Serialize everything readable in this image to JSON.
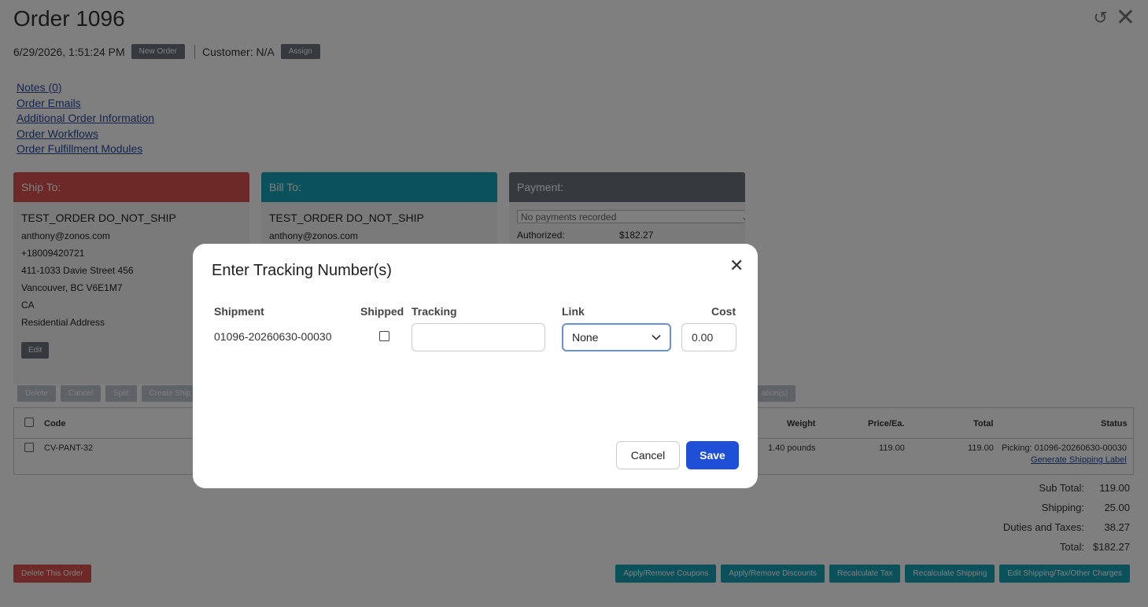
{
  "header": {
    "title": "Order 1096",
    "datetime": "6/29/2026, 1:51:24 PM",
    "new_order_label": "New Order",
    "customer_text": "Customer: N/A",
    "assign_label": "Assign"
  },
  "links": [
    "Notes (0)",
    "Order Emails",
    "Additional Order Information",
    "Order Workflows",
    "Order Fulfillment Modules"
  ],
  "ship_to": {
    "heading": "Ship To:",
    "name": "TEST_ORDER DO_NOT_SHIP",
    "email": "anthony@zonos.com",
    "phone": "+18009420721",
    "street": "411-1033 Davie Street 456",
    "city": "Vancouver, BC V6E1M7",
    "country": "CA",
    "address_type": "Residential Address",
    "edit_label": "Edit",
    "color": "#d9534f"
  },
  "bill_to": {
    "heading": "Bill To:",
    "name": "TEST_ORDER DO_NOT_SHIP",
    "email": "anthony@zonos.com",
    "color": "#17a2b8"
  },
  "payment": {
    "heading": "Payment:",
    "select_value": "No payments recorded",
    "authorized_label": "Authorized:",
    "authorized_value": "$182.27",
    "color": "#6c757d"
  },
  "actions": [
    "Delete",
    "Cancel",
    "Split",
    "Create Ship"
  ],
  "actions_right": "ation(s)",
  "table": {
    "headers": {
      "code": "Code",
      "weight": "Weight",
      "price": "Price/Ea.",
      "total": "Total",
      "status": "Status"
    },
    "row": {
      "code": "CV-PANT-32",
      "weight": "1.40 pounds",
      "price": "119.00",
      "total": "119.00",
      "status": "Picking: 01096-20260630-00030",
      "status_link": "Generate Shipping Label"
    }
  },
  "totals": [
    {
      "label": "Sub Total:",
      "value": "119.00"
    },
    {
      "label": "Shipping:",
      "value": "25.00"
    },
    {
      "label": "Duties and Taxes:",
      "value": "38.27"
    },
    {
      "label": "Total:",
      "value": "$182.27"
    }
  ],
  "footer": {
    "delete_label": "Delete This Order",
    "buttons": [
      "Apply/Remove Coupons",
      "Apply/Remove Discounts",
      "Recalculate Tax",
      "Recalculate Shipping",
      "Edit Shipping/Tax/Other Charges"
    ]
  },
  "modal": {
    "title": "Enter Tracking Number(s)",
    "columns": {
      "shipment": "Shipment",
      "shipped": "Shipped",
      "tracking": "Tracking",
      "link": "Link",
      "cost": "Cost"
    },
    "shipment_id": "01096-20260630-00030",
    "shipped_checked": false,
    "tracking_value": "",
    "link_value": "None",
    "cost_value": "0.00",
    "cancel_label": "Cancel",
    "save_label": "Save"
  }
}
